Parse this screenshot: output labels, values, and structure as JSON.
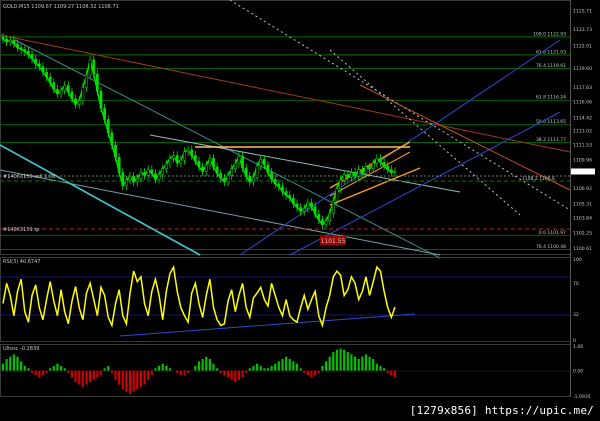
{
  "main_header": "GOLD,M15  1109.67 1109.27 1108.32 1108.71",
  "ind1_header": "RSI(3) 40.6747",
  "ind2_header": "Ultosc -0.2839",
  "watermark": "[1279x856] https://upic.me/",
  "colors": {
    "background": "#000000",
    "candles": "#00e000",
    "fib_lines": "#008000",
    "rsi_line": "#ffff00",
    "hist_up": "#00c000",
    "hist_down": "#d00000",
    "trend_red": "#a03a1a",
    "trend_orange": "#ff9a20",
    "trend_cyan": "#40c8d0",
    "trend_blue": "#2b4bd0",
    "grid": "#202020"
  },
  "chart_data": [
    {
      "type": "line",
      "title": "GOLD,M15",
      "series": [
        {
          "name": "close",
          "values": [
            1122.7,
            1122.4,
            1122.6,
            1122.2,
            1121.8,
            1121.6,
            1121.4,
            1121.1,
            1120.6,
            1120.1,
            1119.8,
            1119.2,
            1118.7,
            1118.1,
            1117.4,
            1116.9,
            1117.3,
            1117.8,
            1117.1,
            1116.4,
            1115.8,
            1116.2,
            1117.6,
            1118.9,
            1120.5,
            1119.0,
            1117.2,
            1115.4,
            1114.2,
            1112.8,
            1111.5,
            1110.2,
            1108.6,
            1107.2,
            1107.8,
            1108.2,
            1107.6,
            1108.0,
            1108.6,
            1108.3,
            1108.9,
            1108.5,
            1107.9,
            1108.4,
            1109.0,
            1109.5,
            1110.1,
            1110.4,
            1109.6,
            1109.9,
            1110.8,
            1111.0,
            1110.4,
            1109.8,
            1109.2,
            1108.7,
            1109.4,
            1110.1,
            1109.2,
            1108.5,
            1108.0,
            1107.6,
            1108.3,
            1109.0,
            1109.6,
            1110.3,
            1109.1,
            1108.2,
            1107.6,
            1108.1,
            1109.3,
            1110.0,
            1109.4,
            1108.6,
            1107.9,
            1107.4,
            1107.1,
            1106.6,
            1106.2,
            1105.9,
            1105.3,
            1104.9,
            1104.5,
            1104.8,
            1105.4,
            1105.0,
            1104.2,
            1103.6,
            1103.1,
            1103.5,
            1104.3,
            1105.6,
            1106.9,
            1107.8,
            1108.4,
            1108.1,
            1108.6,
            1108.2,
            1108.9,
            1108.5,
            1109.2,
            1109.0,
            1109.6,
            1110.1,
            1109.7,
            1109.3,
            1108.9,
            1108.6,
            1108.71
          ]
        }
      ],
      "price_axis_labels": [
        "1125.71",
        "1123.73",
        "1122.01",
        "1119.60",
        "1117.63",
        "1116.06",
        "1114.42",
        "1113.02",
        "1111.53",
        "1109.96",
        "1108.71",
        "1106.92",
        "1105.31",
        "1103.84",
        "1102.25",
        "1100.61"
      ],
      "ylim": [
        1100.2,
        1126.2
      ],
      "fib_levels": [
        {
          "label": "100.0  1122.93",
          "price": 1122.93
        },
        {
          "label": "61.8  1121.03",
          "price": 1121.03
        },
        {
          "label": "76.4  1119.61",
          "price": 1119.61
        },
        {
          "label": "61.8  1116.24",
          "price": 1116.24
        },
        {
          "label": "50.0  1113.65",
          "price": 1113.65
        },
        {
          "label": "38.2  1111.77",
          "price": 1111.77
        },
        {
          "label": "0.0  1101.97",
          "price": 1101.97
        },
        {
          "label": "76.4  1100.48",
          "price": 1100.48
        }
      ],
      "line_labels": [
        {
          "label": "#14063159 sell 1.00",
          "price": 1108.0
        },
        {
          "label": "#14063159 tp",
          "price": 1102.95
        },
        {
          "label": "1108.2  1106.6",
          "price": 1108.0
        }
      ],
      "tag_label": "1101.55",
      "grid": true
    },
    {
      "type": "line",
      "title": "RSI(3) 40.6747",
      "series": [
        {
          "name": "RSI(3)",
          "values": [
            45,
            70,
            55,
            30,
            60,
            75,
            35,
            22,
            55,
            68,
            40,
            25,
            50,
            72,
            48,
            30,
            62,
            35,
            20,
            48,
            66,
            40,
            25,
            58,
            70,
            50,
            30,
            65,
            55,
            28,
            18,
            45,
            62,
            30,
            20,
            58,
            85,
            72,
            78,
            45,
            30,
            60,
            75,
            55,
            25,
            60,
            82,
            90,
            60,
            40,
            30,
            22,
            58,
            70,
            45,
            28,
            55,
            75,
            40,
            25,
            18,
            20,
            48,
            62,
            35,
            55,
            70,
            40,
            28,
            52,
            58,
            65,
            50,
            42,
            70,
            55,
            40,
            30,
            50,
            30,
            25,
            22,
            40,
            55,
            38,
            50,
            60,
            30,
            18,
            40,
            55,
            78,
            85,
            80,
            55,
            62,
            78,
            70,
            50,
            60,
            78,
            55,
            72,
            90,
            85,
            60,
            40,
            28,
            40.67
          ]
        }
      ],
      "axis_labels": [
        "100",
        "70",
        "32",
        "0"
      ],
      "ylim": [
        0,
        100
      ]
    },
    {
      "type": "bar",
      "title": "Ultosc -0.2839",
      "series": [
        {
          "name": "Ultosc",
          "values": [
            0.3,
            0.5,
            0.6,
            0.7,
            0.6,
            0.4,
            0.2,
            0.1,
            -0.1,
            -0.2,
            -0.3,
            -0.2,
            -0.1,
            0.1,
            0.2,
            0.3,
            0.2,
            0.1,
            -0.1,
            -0.3,
            -0.5,
            -0.6,
            -0.7,
            -0.6,
            -0.5,
            -0.4,
            -0.3,
            -0.2,
            0.1,
            0.2,
            -0.1,
            -0.4,
            -0.6,
            -0.8,
            -0.9,
            -1.0,
            -0.9,
            -0.8,
            -0.7,
            -0.6,
            -0.4,
            -0.2,
            0.1,
            0.2,
            0.3,
            0.2,
            0.1,
            0.0,
            -0.1,
            -0.2,
            -0.2,
            -0.1,
            0.0,
            0.2,
            0.4,
            0.5,
            0.6,
            0.5,
            0.3,
            0.1,
            -0.1,
            -0.2,
            -0.3,
            -0.4,
            -0.5,
            -0.4,
            -0.3,
            -0.1,
            0.1,
            0.2,
            0.3,
            0.2,
            0.1,
            0.1,
            0.2,
            0.3,
            0.4,
            0.5,
            0.6,
            0.5,
            0.4,
            0.3,
            0.1,
            -0.1,
            -0.2,
            -0.3,
            -0.2,
            -0.1,
            0.2,
            0.4,
            0.6,
            0.8,
            0.9,
            0.95,
            0.9,
            0.8,
            0.7,
            0.6,
            0.5,
            0.6,
            0.7,
            0.6,
            0.5,
            0.3,
            0.2,
            0.1,
            -0.1,
            -0.2,
            -0.28
          ]
        }
      ],
      "axis_labels": [
        "1.06",
        "0.00",
        "-1.0935"
      ],
      "ylim": [
        -1.0935,
        1.06
      ]
    }
  ]
}
